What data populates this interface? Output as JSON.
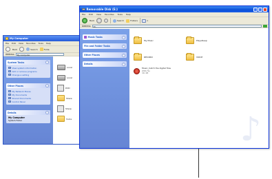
{
  "back_window": {
    "title": "My Computer",
    "menu": [
      "File",
      "Edit",
      "View",
      "Favorites",
      "Tools",
      "Help"
    ],
    "toolbar": {
      "back": "Back",
      "search": "Search",
      "folders": "Folde"
    },
    "address": {
      "label": "Address",
      "value": "My Computer"
    },
    "system_tasks": {
      "title": "System Tasks",
      "items": [
        "View system information",
        "Add or remove programs",
        "Change a setting"
      ]
    },
    "other_places": {
      "title": "Other Places",
      "items": [
        "My Network Places",
        "My Documents",
        "Shared Documents",
        "Control Panel"
      ]
    },
    "details": {
      "title": "Details",
      "name": "My Computer",
      "subtitle": "System Folder"
    },
    "drives": [
      "Local",
      "Local",
      "DVD",
      "Share",
      "Sharp",
      "Vulca"
    ]
  },
  "front_window": {
    "title": "Removable Disk (E:)",
    "menu": [
      "File",
      "Edit",
      "View",
      "Favorites",
      "Tools",
      "Help"
    ],
    "toolbar": {
      "back": "Back",
      "search": "Search",
      "folders": "Folders"
    },
    "address": {
      "label": "Address",
      "value": "E:\\"
    },
    "music_tasks": {
      "title": "Music Tasks"
    },
    "file_folder_tasks": {
      "title": "File and Folder Tasks"
    },
    "other_places": {
      "title": "Other Places"
    },
    "details": {
      "title": "Details"
    },
    "items": [
      {
        "name": "My Music"
      },
      {
        "name": "PlaysDeep"
      },
      {
        "name": "RECORD"
      },
      {
        "name": "VOICE"
      }
    ],
    "wma_file": {
      "name": "Music_Catch the digital flow",
      "type": "WMA File",
      "size": "341 KB"
    }
  }
}
